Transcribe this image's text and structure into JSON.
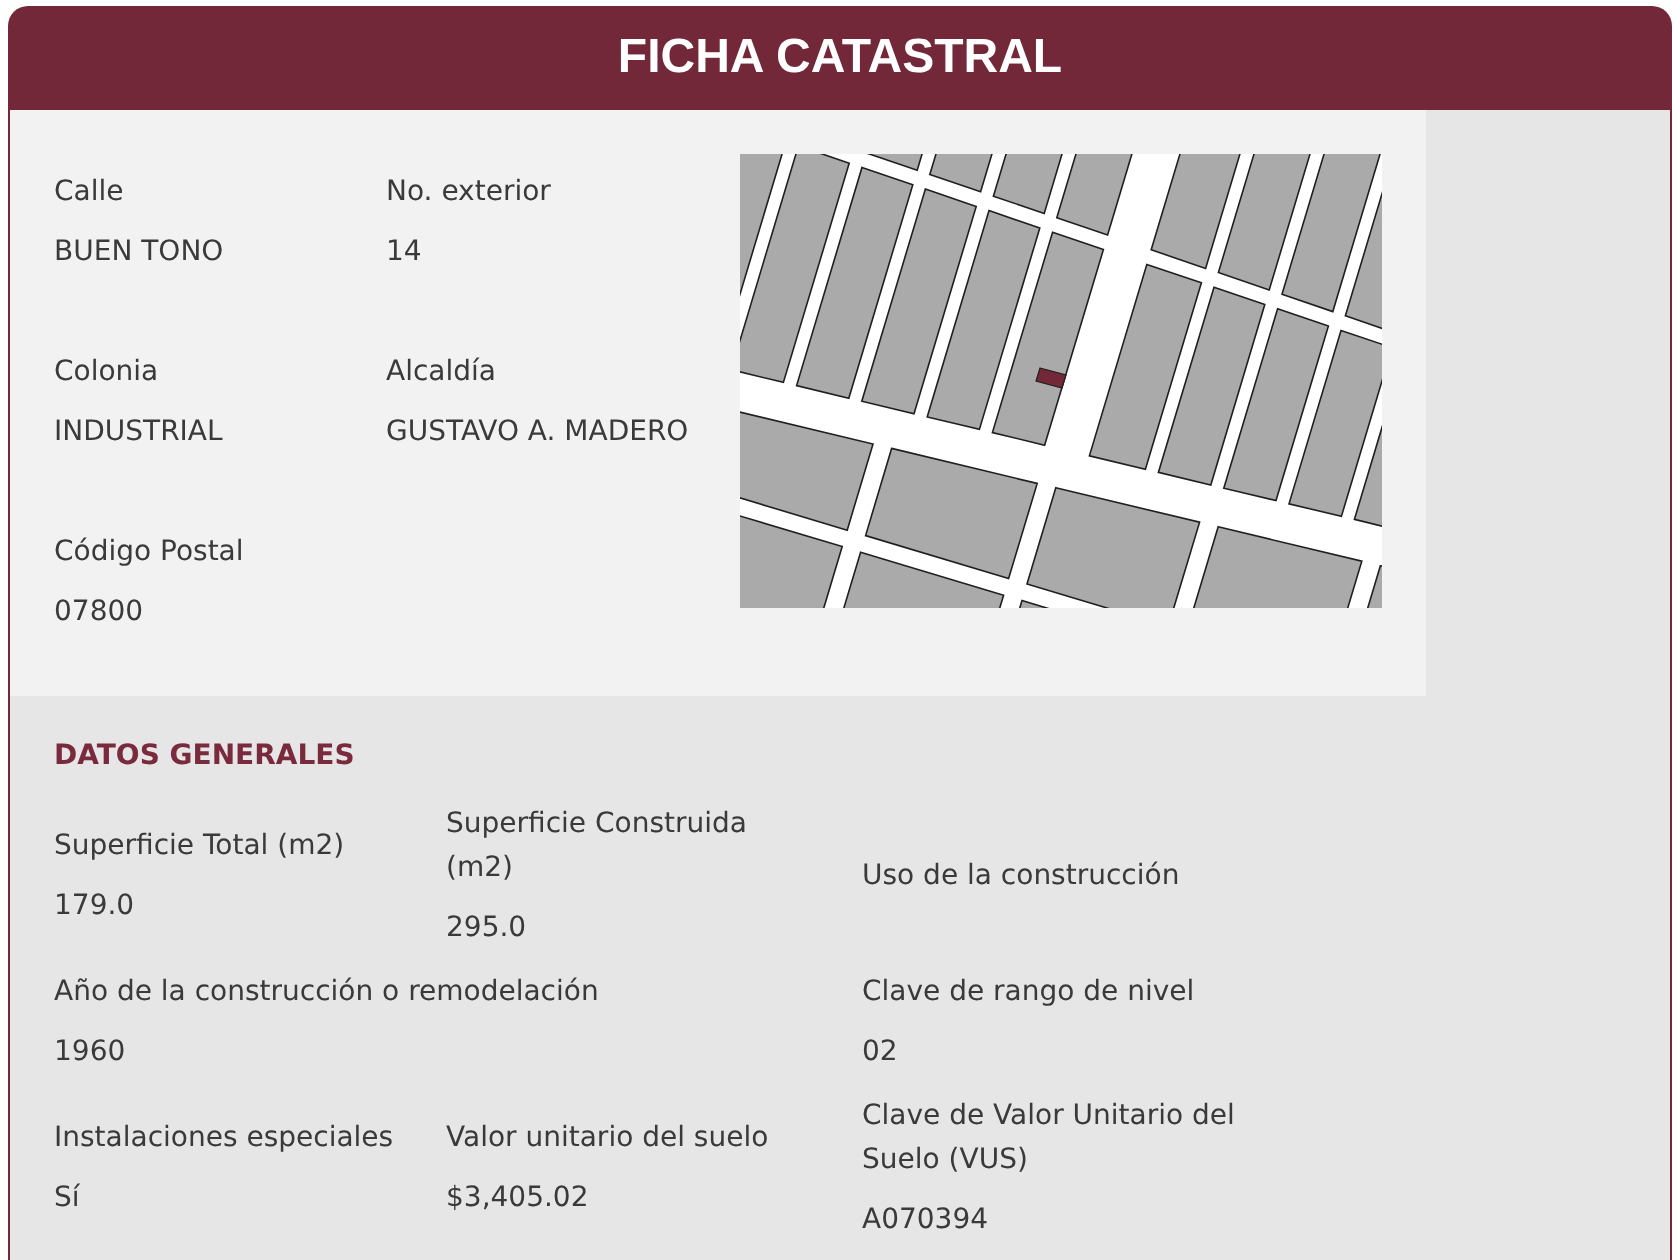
{
  "header": {
    "title": "FICHA CATASTRAL"
  },
  "location": {
    "rows": [
      [
        {
          "label": "Calle",
          "value": "BUEN TONO"
        },
        {
          "label": "No. exterior",
          "value": "14"
        }
      ],
      [
        {
          "label": "Colonia",
          "value": "INDUSTRIAL"
        },
        {
          "label": "Alcaldía",
          "value": "GUSTAVO A. MADERO"
        }
      ],
      [
        {
          "label": "Código Postal",
          "value": "07800"
        }
      ]
    ]
  },
  "general_data": {
    "title": "DATOS GENERALES",
    "rows": [
      [
        {
          "label": "Superficie Total (m2)",
          "value": "179.0"
        },
        {
          "label": "Superficie Construida (m2)",
          "value": "295.0"
        },
        {
          "label": "Uso de la construcción"
        }
      ],
      [
        {
          "label": "Año de la construcción o remodelación",
          "value": "1960",
          "colspan": 2
        },
        {
          "label": "Clave de rango de nivel",
          "value": "02"
        }
      ],
      [
        {
          "label": "Instalaciones especiales",
          "value": "Sí"
        },
        {
          "label": "Valor unitario del suelo",
          "value": "$3,405.02"
        },
        {
          "label": "Clave de Valor Unitario del Suelo (VUS)",
          "value": "A070394"
        }
      ]
    ]
  }
}
